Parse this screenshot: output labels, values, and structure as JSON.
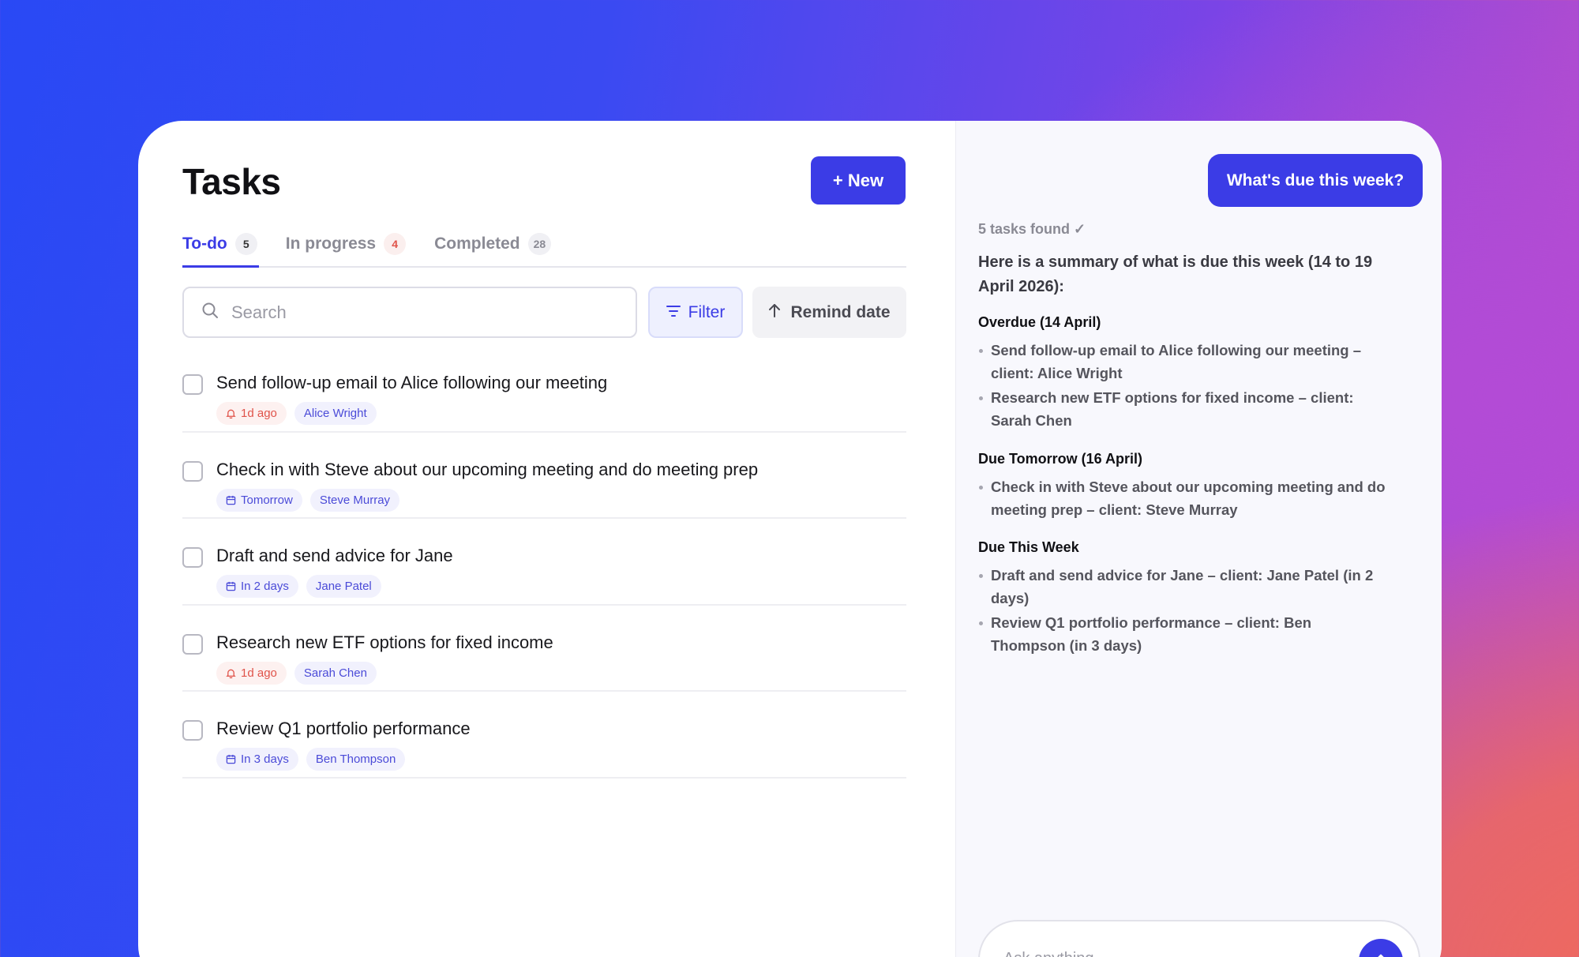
{
  "app": {
    "title": "Tasks",
    "new_label": "+ New"
  },
  "tabs": [
    {
      "label": "To-do",
      "count": "5"
    },
    {
      "label": "In progress",
      "count": "4"
    },
    {
      "label": "Completed",
      "count": "28"
    }
  ],
  "search": {
    "placeholder": "Search"
  },
  "toolbar": {
    "filter_label": "Filter",
    "remind_label": "Remind date"
  },
  "tasks": [
    {
      "title": "Send follow-up email to Alice following our meeting",
      "when": "1d ago",
      "when_kind": "overdue",
      "client": "Alice Wright"
    },
    {
      "title": "Check in with Steve about our upcoming meeting and do meeting prep",
      "when": "Tomorrow",
      "when_kind": "upcoming",
      "client": "Steve Murray"
    },
    {
      "title": "Draft and send advice for Jane",
      "when": "In 2 days",
      "when_kind": "upcoming",
      "client": "Jane Patel"
    },
    {
      "title": "Research new ETF options for fixed income",
      "when": "1d ago",
      "when_kind": "overdue",
      "client": "Sarah Chen"
    },
    {
      "title": "Review Q1 portfolio performance",
      "when": "In 3 days",
      "when_kind": "upcoming",
      "client": "Ben Thompson"
    }
  ],
  "assistant": {
    "user_message": "What's due this week?",
    "status": "5 tasks found ✓",
    "summary": "Here is a summary of what is due this week (14 to 19 April 2026):",
    "sections": [
      {
        "heading": "Overdue (14 April)",
        "items": [
          "Send follow-up email to Alice following our meeting – client: Alice Wright",
          "Research new ETF options for fixed income – client: Sarah Chen"
        ]
      },
      {
        "heading": "Due Tomorrow (16 April)",
        "items": [
          "Check in with Steve about our upcoming meeting and do meeting prep – client: Steve Murray"
        ]
      },
      {
        "heading": "Due This Week",
        "items": [
          "Draft and send advice for Jane – client: Jane Patel (in 2 days)",
          "Review Q1 portfolio performance – client: Ben Thompson (in 3 days)"
        ]
      }
    ],
    "input_placeholder": "Ask anything..."
  },
  "colors": {
    "accent": "#3b3ce6",
    "overdue": "#e0534a",
    "tag_purple": "#4b4bd8"
  },
  "icons": {
    "search": "search-icon",
    "filter": "filter-icon",
    "sort": "arrow-up-icon",
    "overdue": "bell-icon",
    "upcoming": "calendar-icon",
    "send": "arrow-up-icon"
  }
}
